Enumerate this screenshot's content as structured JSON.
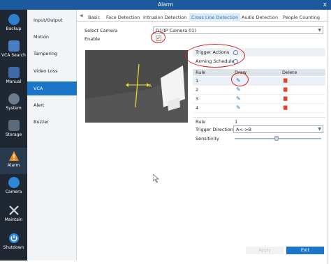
{
  "window": {
    "title": "Alarm",
    "close_glyph": "x"
  },
  "leftnav": [
    {
      "label": "Backup",
      "icon": "backup-icon",
      "color": "#2f7fd1"
    },
    {
      "label": "VCA Search",
      "icon": "vca-search-icon",
      "color": "#4a7dc2"
    },
    {
      "label": "Manual",
      "icon": "manual-icon",
      "color": "#3e6aa8"
    },
    {
      "label": "System",
      "icon": "system-icon",
      "color": "#6d7c8c"
    },
    {
      "label": "Storage",
      "icon": "storage-icon",
      "color": "#5a6a7a"
    },
    {
      "label": "Alarm",
      "icon": "alarm-icon",
      "color": "#e88a1c"
    },
    {
      "label": "Camera",
      "icon": "camera-icon",
      "color": "#2e86d6"
    },
    {
      "label": "Maintain",
      "icon": "maintain-icon",
      "color": "#d6d6d6"
    },
    {
      "label": "Shutdown",
      "icon": "shutdown-icon",
      "color": "#2e86d6"
    }
  ],
  "submenu": [
    "Input/Output",
    "Motion",
    "Tampering",
    "Video Loss",
    "VCA",
    "Alert",
    "Buzzer"
  ],
  "tabs": [
    "Basic",
    "Face Detection",
    "Intrusion Detection",
    "Cross Line Detection",
    "Audio Detection",
    "People Counting"
  ],
  "form": {
    "select_camera_label": "Select Camera",
    "select_camera_value": "D1(IP Camera 01)",
    "enable_label": "Enable",
    "enable_check": "✔"
  },
  "video": {
    "overlay_label": "A"
  },
  "actions": {
    "trigger_actions": "Trigger Actions",
    "arming_schedule": "Arming Schedule"
  },
  "rules_table": {
    "headers": [
      "Rule",
      "Draw",
      "Delete"
    ],
    "rows": [
      "1",
      "2",
      "3",
      "4"
    ]
  },
  "rule_settings": {
    "rule_label": "Rule",
    "rule_value": "1",
    "direction_label": "Trigger Direction",
    "direction_value": "A<->B",
    "sensitivity_label": "Sensitivity",
    "sensitivity_level": 0.48
  },
  "buttons": {
    "apply": "Apply",
    "exit": "Exit"
  },
  "colors": {
    "accent": "#1b76c9",
    "annotation": "#d32020",
    "delete": "#e0452b"
  }
}
